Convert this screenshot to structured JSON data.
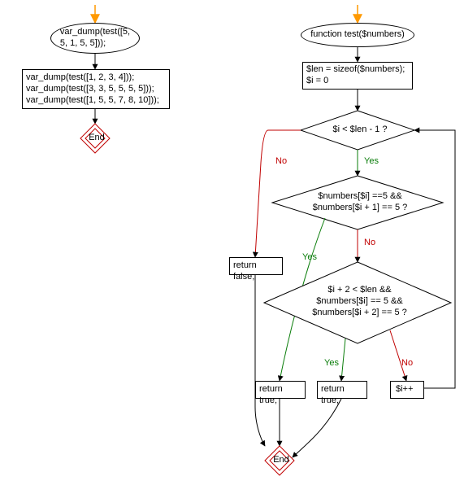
{
  "left": {
    "start_call": "var_dump(test([5,\n5, 1, 5, 5]));",
    "calls": "var_dump(test([1, 2, 3, 4]));\nvar_dump(test([3, 3, 5, 5, 5, 5]));\nvar_dump(test([1, 5, 5, 7, 8, 10]));",
    "end": "End"
  },
  "right": {
    "func": "function test($numbers)",
    "init": "$len = sizeof($numbers);\n$i = 0",
    "cond_loop": "$i < $len - 1 ?",
    "cond_adj": "$numbers[$i] ==5 &&\n$numbers[$i + 1] == 5 ?",
    "cond_skip": "$i + 2 < $len &&\n$numbers[$i] == 5 &&\n$numbers[$i + 2] == 5 ?",
    "ret_false": "return false;",
    "ret_true1": "return true;",
    "ret_true2": "return true;",
    "inc": "$i++",
    "end": "End"
  },
  "labels": {
    "yes": "Yes",
    "no": "No"
  },
  "chart_data": {
    "type": "flowchart",
    "flows": [
      {
        "name": "caller",
        "nodes": [
          {
            "id": "c_start",
            "shape": "startend",
            "text": "var_dump(test([5, 5, 1, 5, 5]));"
          },
          {
            "id": "c_rect",
            "shape": "process",
            "text": "var_dump(test([1, 2, 3, 4]));\nvar_dump(test([3, 3, 5, 5, 5, 5]));\nvar_dump(test([1, 5, 5, 7, 8, 10]));"
          },
          {
            "id": "c_end",
            "shape": "end",
            "text": "End"
          }
        ],
        "edges": [
          {
            "from": "c_start",
            "to": "c_rect"
          },
          {
            "from": "c_rect",
            "to": "c_end"
          }
        ]
      },
      {
        "name": "test",
        "nodes": [
          {
            "id": "f_start",
            "shape": "startend",
            "text": "function test($numbers)"
          },
          {
            "id": "f_init",
            "shape": "process",
            "text": "$len = sizeof($numbers);\n$i = 0"
          },
          {
            "id": "d_loop",
            "shape": "decision",
            "text": "$i < $len - 1 ?"
          },
          {
            "id": "d_adj",
            "shape": "decision",
            "text": "$numbers[$i] ==5 && $numbers[$i + 1] == 5 ?"
          },
          {
            "id": "d_skip",
            "shape": "decision",
            "text": "$i + 2 < $len && $numbers[$i] == 5 && $numbers[$i + 2] == 5 ?"
          },
          {
            "id": "r_false",
            "shape": "process",
            "text": "return false;"
          },
          {
            "id": "r_true1",
            "shape": "process",
            "text": "return true;"
          },
          {
            "id": "r_true2",
            "shape": "process",
            "text": "return true;"
          },
          {
            "id": "inc",
            "shape": "process",
            "text": "$i++"
          },
          {
            "id": "f_end",
            "shape": "end",
            "text": "End"
          }
        ],
        "edges": [
          {
            "from": "f_start",
            "to": "f_init"
          },
          {
            "from": "f_init",
            "to": "d_loop"
          },
          {
            "from": "d_loop",
            "to": "d_adj",
            "label": "Yes"
          },
          {
            "from": "d_loop",
            "to": "r_false",
            "label": "No"
          },
          {
            "from": "d_adj",
            "to": "r_true1",
            "label": "Yes"
          },
          {
            "from": "d_adj",
            "to": "d_skip",
            "label": "No"
          },
          {
            "from": "d_skip",
            "to": "r_true2",
            "label": "Yes"
          },
          {
            "from": "d_skip",
            "to": "inc",
            "label": "No"
          },
          {
            "from": "inc",
            "to": "d_loop",
            "back": true
          },
          {
            "from": "r_false",
            "to": "f_end"
          },
          {
            "from": "r_true1",
            "to": "f_end"
          },
          {
            "from": "r_true2",
            "to": "f_end"
          }
        ]
      }
    ]
  }
}
